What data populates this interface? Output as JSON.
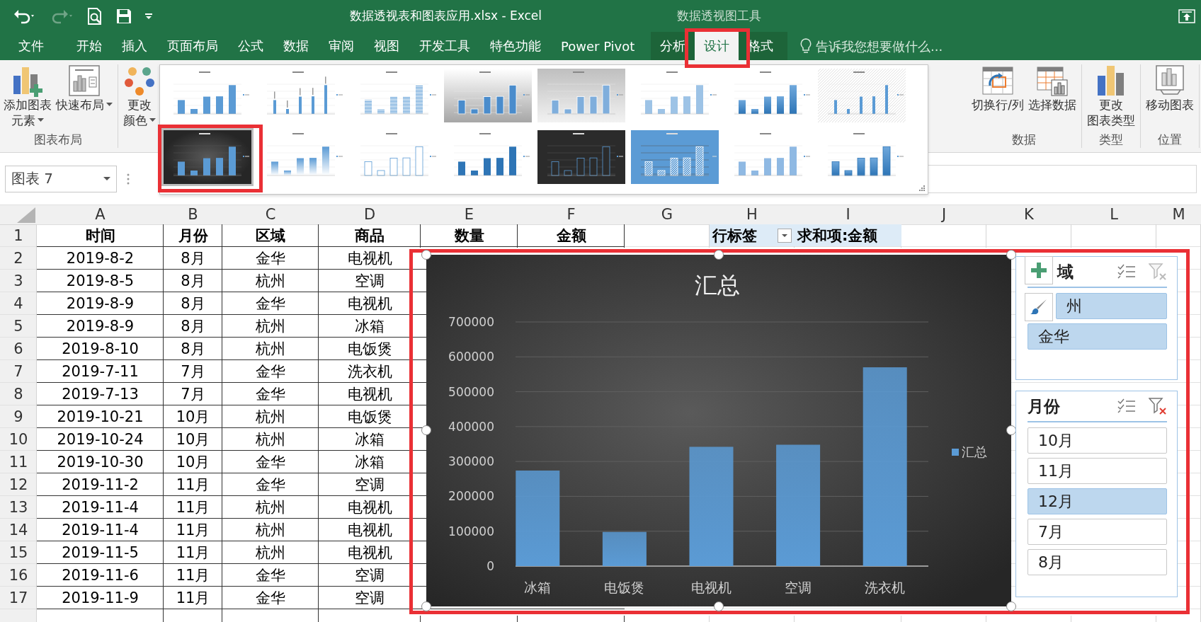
{
  "window": {
    "title": "数据透视表和图表应用.xlsx - Excel",
    "context_group": "数据透视图工具"
  },
  "tabs": [
    {
      "label": "文件",
      "selected": false
    },
    {
      "label": "开始",
      "selected": false
    },
    {
      "label": "插入",
      "selected": false
    },
    {
      "label": "页面布局",
      "selected": false
    },
    {
      "label": "公式",
      "selected": false
    },
    {
      "label": "数据",
      "selected": false
    },
    {
      "label": "审阅",
      "selected": false
    },
    {
      "label": "视图",
      "selected": false
    },
    {
      "label": "开发工具",
      "selected": false
    },
    {
      "label": "特色功能",
      "selected": false
    },
    {
      "label": "Power Pivot",
      "selected": false
    }
  ],
  "context_tabs": [
    {
      "label": "分析",
      "selected": false
    },
    {
      "label": "设计",
      "selected": true
    },
    {
      "label": "格式",
      "selected": false
    }
  ],
  "tell_me": {
    "placeholder": "告诉我您想要做什么..."
  },
  "ribbon": {
    "groups_left": [
      {
        "label": "图表布局",
        "buttons": [
          {
            "lines": [
              "添加图表",
              "元素"
            ],
            "kind": "add-element",
            "dropdown": true
          },
          {
            "lines": [
              "快速布局"
            ],
            "kind": "quick-layout",
            "dropdown": true
          }
        ]
      },
      {
        "buttons": [
          {
            "lines": [
              "更改",
              "颜色"
            ],
            "kind": "colors",
            "dropdown": true
          }
        ]
      }
    ],
    "gallery": {
      "styles": [
        {
          "kind": "plain",
          "selected": false
        },
        {
          "kind": "labeled",
          "selected": false
        },
        {
          "kind": "striped",
          "selected": false
        },
        {
          "kind": "shaded",
          "selected": false
        },
        {
          "kind": "gray",
          "selected": false
        },
        {
          "kind": "pale",
          "selected": false
        },
        {
          "kind": "gradient",
          "selected": false
        },
        {
          "kind": "hatched-bg",
          "selected": false
        },
        {
          "kind": "dark",
          "selected": true
        },
        {
          "kind": "faded",
          "selected": false
        },
        {
          "kind": "outline",
          "selected": false
        },
        {
          "kind": "grid",
          "selected": false
        },
        {
          "kind": "dark-outline",
          "selected": false
        },
        {
          "kind": "blue",
          "selected": false
        },
        {
          "kind": "soft",
          "selected": false
        },
        {
          "kind": "deep",
          "selected": false
        }
      ]
    },
    "groups_right": [
      {
        "label": "数据",
        "buttons": [
          {
            "lines": [
              "切换行/列"
            ],
            "kind": "switch",
            "dropdown": false
          },
          {
            "lines": [
              "选择数据"
            ],
            "kind": "select-data",
            "dropdown": false
          }
        ]
      },
      {
        "label": "类型",
        "buttons": [
          {
            "lines": [
              "更改",
              "图表类型"
            ],
            "kind": "chart-type",
            "dropdown": false
          }
        ]
      },
      {
        "label": "位置",
        "buttons": [
          {
            "lines": [
              "移动图表"
            ],
            "kind": "move-chart",
            "dropdown": false
          }
        ]
      }
    ]
  },
  "name_box": {
    "value": "图表 7"
  },
  "sheet": {
    "columns": [
      "A",
      "B",
      "C",
      "D",
      "E",
      "F",
      "G",
      "H",
      "I",
      "J",
      "K",
      "L",
      "M"
    ],
    "pivot_header": {
      "row_label": "行标签",
      "value_label": "求和项:金额"
    },
    "rows": [
      {
        "number": "1",
        "header": true,
        "values": [
          "时间",
          "月份",
          "区域",
          "商品",
          "数量",
          "金额"
        ]
      },
      {
        "number": "2",
        "header": false,
        "values": [
          "2019-8-2",
          "8月",
          "金华",
          "电视机"
        ]
      },
      {
        "number": "3",
        "header": false,
        "values": [
          "2019-8-5",
          "8月",
          "杭州",
          "空调"
        ]
      },
      {
        "number": "4",
        "header": false,
        "values": [
          "2019-8-9",
          "8月",
          "金华",
          "电视机"
        ]
      },
      {
        "number": "5",
        "header": false,
        "values": [
          "2019-8-9",
          "8月",
          "杭州",
          "冰箱"
        ]
      },
      {
        "number": "6",
        "header": false,
        "values": [
          "2019-8-10",
          "8月",
          "杭州",
          "电饭煲"
        ]
      },
      {
        "number": "7",
        "header": false,
        "values": [
          "2019-7-11",
          "7月",
          "金华",
          "洗衣机"
        ]
      },
      {
        "number": "8",
        "header": false,
        "values": [
          "2019-7-13",
          "7月",
          "金华",
          "电视机"
        ]
      },
      {
        "number": "9",
        "header": false,
        "values": [
          "2019-10-21",
          "10月",
          "杭州",
          "电饭煲"
        ]
      },
      {
        "number": "10",
        "header": false,
        "values": [
          "2019-10-24",
          "10月",
          "杭州",
          "冰箱"
        ]
      },
      {
        "number": "11",
        "header": false,
        "values": [
          "2019-10-30",
          "10月",
          "金华",
          "冰箱"
        ]
      },
      {
        "number": "12",
        "header": false,
        "values": [
          "2019-11-2",
          "11月",
          "金华",
          "空调"
        ]
      },
      {
        "number": "13",
        "header": false,
        "values": [
          "2019-11-4",
          "11月",
          "杭州",
          "电视机"
        ]
      },
      {
        "number": "14",
        "header": false,
        "values": [
          "2019-11-4",
          "11月",
          "杭州",
          "电视机"
        ]
      },
      {
        "number": "15",
        "header": false,
        "values": [
          "2019-11-5",
          "11月",
          "杭州",
          "电视机"
        ]
      },
      {
        "number": "16",
        "header": false,
        "values": [
          "2019-11-6",
          "11月",
          "金华",
          "空调"
        ]
      },
      {
        "number": "17",
        "header": false,
        "values": [
          "2019-11-9",
          "11月",
          "金华",
          "空调"
        ]
      }
    ]
  },
  "chart": {
    "chart_data": {
      "type": "bar",
      "title": "汇总",
      "categories": [
        "冰箱",
        "电饭煲",
        "电视机",
        "空调",
        "洗衣机"
      ],
      "series": [
        {
          "name": "汇总",
          "color": "#5b9bd5",
          "values": [
            274000,
            98000,
            342000,
            348000,
            570000
          ]
        }
      ],
      "ylim": [
        0,
        700000
      ],
      "grid": true,
      "yticks": [
        0,
        100000,
        200000,
        300000,
        400000,
        500000,
        600000,
        700000
      ]
    }
  },
  "slicers": [
    {
      "title": "域",
      "filtered": false,
      "items": [
        {
          "label": "州",
          "selected": true
        },
        {
          "label": "金华",
          "selected": true
        }
      ]
    },
    {
      "title": "月份",
      "filtered": true,
      "items": [
        {
          "label": "10月",
          "selected": false
        },
        {
          "label": "11月",
          "selected": false
        },
        {
          "label": "12月",
          "selected": true
        },
        {
          "label": "7月",
          "selected": false
        },
        {
          "label": "8月",
          "selected": false
        }
      ]
    }
  ]
}
